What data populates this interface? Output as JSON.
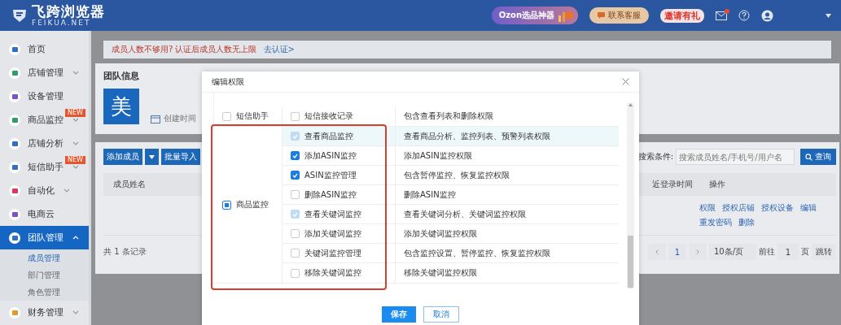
{
  "header": {
    "logo_title": "飞跨浏览器",
    "logo_subtitle": "FEIKUA.NET",
    "promo": "Ozon选品神器",
    "contact_button": "联系客服",
    "invite": "邀请有礼",
    "mail_unread": true
  },
  "sidebar": {
    "items": [
      {
        "label": "首页",
        "color": "#2f6fc4",
        "expandable": false,
        "selected": false
      },
      {
        "label": "店铺管理",
        "color": "#2e9e62",
        "expandable": true,
        "expanded": false,
        "selected": false
      },
      {
        "label": "设备管理",
        "color": "#7b52c9",
        "expandable": false,
        "selected": false
      },
      {
        "label": "商品监控",
        "color": "#2e9e62",
        "badge": "NEW",
        "expandable": true,
        "expanded": false,
        "selected": false
      },
      {
        "label": "店铺分析",
        "color": "#2f6fc4",
        "expandable": true,
        "expanded": false,
        "selected": false
      },
      {
        "label": "短信助手",
        "color": "#2f6fc4",
        "badge": "NEW",
        "expandable": true,
        "expanded": false,
        "selected": false
      },
      {
        "label": "自动化",
        "color": "#d63b5c",
        "expandable": true,
        "expanded": false,
        "selected": false
      },
      {
        "label": "电商云",
        "color": "#7b52c9",
        "expandable": false,
        "selected": false
      },
      {
        "label": "团队管理",
        "color": "#2f6fc4",
        "expandable": true,
        "expanded": true,
        "selected": true,
        "children": [
          {
            "label": "成员管理",
            "selected": true
          },
          {
            "label": "部门管理",
            "selected": false
          },
          {
            "label": "角色管理",
            "selected": false
          }
        ]
      },
      {
        "label": "财务管理",
        "color": "#e09a2b",
        "expandable": true,
        "expanded": false,
        "selected": false
      }
    ]
  },
  "notice": {
    "text": "成员人数不够用? 认证后成员人数无上限",
    "link": "去认证>"
  },
  "team": {
    "title": "团队信息",
    "avatar": "美",
    "created_label": "创建时间"
  },
  "members": {
    "add_button": "添加成员",
    "import_button": "批量导入",
    "search_label": "搜索条件:",
    "search_placeholder": "搜索成员姓名/手机号/用户名",
    "query_button": "查询",
    "columns": [
      "成员姓名",
      "近登录时间",
      "操作"
    ],
    "actions": [
      "权限",
      "授权店铺",
      "授权设备",
      "编辑",
      "重发密码",
      "删除"
    ],
    "total": "共 1 条记录",
    "pagination": {
      "pages": [
        {
          "label": "1",
          "selected": true
        }
      ],
      "page_size": "10条/页",
      "goto_label": "前往",
      "goto_value": "1",
      "page_unit": "页",
      "jump_button": "跳转"
    }
  },
  "dialog": {
    "title": "编辑权限",
    "groups": [
      {
        "label": "短信助手",
        "checked": false,
        "outlined": false,
        "items": [
          {
            "label": "短信接收记录",
            "description": "包含查看列表和删除权限",
            "checked": false,
            "disabled": false,
            "highlighted": false
          }
        ]
      },
      {
        "label": "商品监控",
        "indeterminate": true,
        "outlined": true,
        "items": [
          {
            "label": "查看商品监控",
            "description": "查看商品分析、监控列表、预警列表权限",
            "checked": true,
            "disabled": true,
            "highlighted": true
          },
          {
            "label": "添加ASIN监控",
            "description": "添加ASIN监控权限",
            "checked": true,
            "disabled": false,
            "highlighted": false
          },
          {
            "label": "ASIN监控管理",
            "description": "包含暂停监控、恢复监控权限",
            "checked": true,
            "disabled": false,
            "highlighted": false
          },
          {
            "label": "删除ASIN监控",
            "description": "删除ASIN监控",
            "checked": false,
            "disabled": false,
            "highlighted": false
          },
          {
            "label": "查看关键词监控",
            "description": "查看关键词分析、关键词监控权限",
            "checked": true,
            "disabled": true,
            "highlighted": false
          },
          {
            "label": "添加关键词监控",
            "description": "添加关键词监控权限",
            "checked": false,
            "disabled": false,
            "highlighted": false
          },
          {
            "label": "关键词监控管理",
            "description": "包含监控设置、暂停监控、恢复监控权限",
            "checked": false,
            "disabled": false,
            "highlighted": false
          },
          {
            "label": "移除关键词监控",
            "description": "移除关键词监控权限",
            "checked": false,
            "disabled": false,
            "highlighted": false
          }
        ]
      }
    ],
    "save_button": "保存",
    "cancel_button": "取消"
  }
}
